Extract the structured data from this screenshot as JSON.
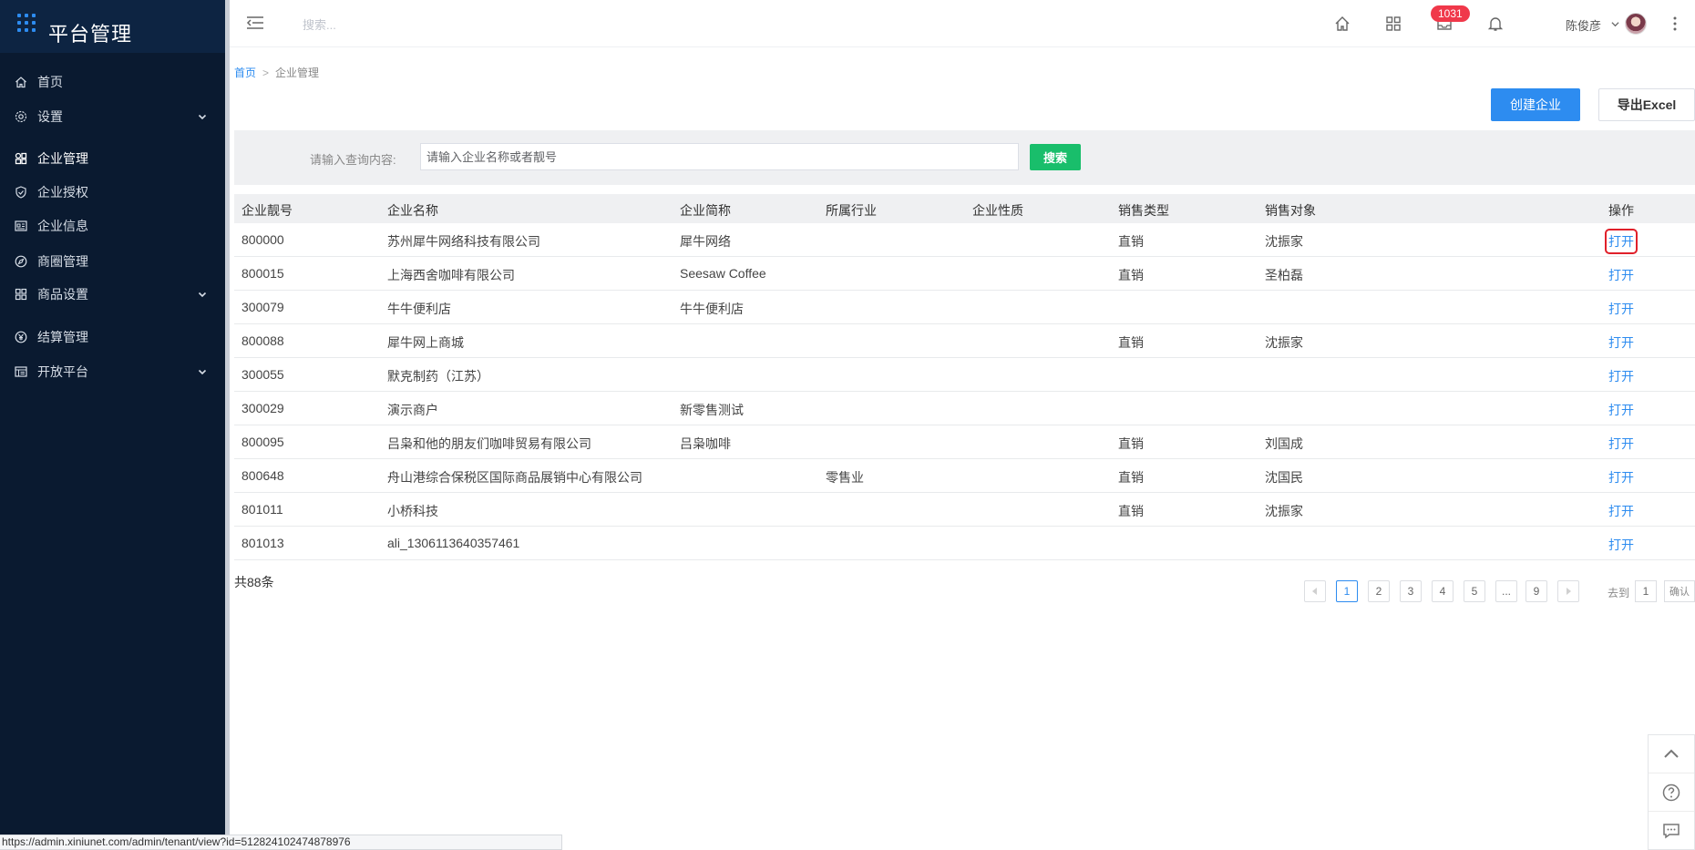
{
  "app": {
    "title": "平台管理"
  },
  "sidebar": {
    "items": [
      {
        "label": "首页",
        "icon": "home-icon",
        "has_children": false,
        "active": false
      },
      {
        "label": "设置",
        "icon": "gear-icon",
        "has_children": true,
        "active": false
      },
      {
        "label": "企业管理",
        "icon": "apps-icon",
        "has_children": false,
        "active": true
      },
      {
        "label": "企业授权",
        "icon": "shield-check-icon",
        "has_children": false,
        "active": false
      },
      {
        "label": "企业信息",
        "icon": "id-card-icon",
        "has_children": false,
        "active": false
      },
      {
        "label": "商圈管理",
        "icon": "compass-icon",
        "has_children": false,
        "active": false
      },
      {
        "label": "商品设置",
        "icon": "grid-icon",
        "has_children": true,
        "active": false
      },
      {
        "label": "结算管理",
        "icon": "yen-circle-icon",
        "has_children": false,
        "active": false
      },
      {
        "label": "开放平台",
        "icon": "list-card-icon",
        "has_children": true,
        "active": false
      }
    ]
  },
  "topbar": {
    "search_placeholder": "搜索...",
    "notification_count": "1031",
    "username": "陈俊彦",
    "icons": [
      "home-icon",
      "grid-icon",
      "message-icon",
      "bell-icon",
      "more-vertical-icon"
    ]
  },
  "breadcrumb": {
    "home": "首页",
    "separator": ">",
    "current": "企业管理"
  },
  "actions": {
    "create_label": "创建企业",
    "export_label": "导出Excel"
  },
  "filter": {
    "label": "请输入查询内容:",
    "placeholder": "请输入企业名称或者靓号",
    "search_label": "搜索"
  },
  "table": {
    "columns": [
      "企业靓号",
      "企业名称",
      "企业简称",
      "所属行业",
      "企业性质",
      "销售类型",
      "销售对象",
      "操作"
    ],
    "action_label": "打开",
    "rows": [
      [
        "800000",
        "苏州犀牛网络科技有限公司",
        "犀牛网络",
        "",
        "",
        "直销",
        "沈振家"
      ],
      [
        "800015",
        "上海西舍咖啡有限公司",
        "Seesaw Coffee",
        "",
        "",
        "直销",
        "圣柏磊"
      ],
      [
        "300079",
        "牛牛便利店",
        "牛牛便利店",
        "",
        "",
        "",
        ""
      ],
      [
        "800088",
        "犀牛网上商城",
        "",
        "",
        "",
        "直销",
        "沈振家"
      ],
      [
        "300055",
        "默克制药（江苏）",
        "",
        "",
        "",
        "",
        ""
      ],
      [
        "300029",
        "演示商户",
        "新零售测试",
        "",
        "",
        "",
        ""
      ],
      [
        "800095",
        "吕枭和他的朋友们咖啡贸易有限公司",
        "吕枭咖啡",
        "",
        "",
        "直销",
        "刘国成"
      ],
      [
        "800648",
        "舟山港综合保税区国际商品展销中心有限公司",
        "",
        "零售业",
        "",
        "直销",
        "沈国民"
      ],
      [
        "801011",
        "小桥科技",
        "",
        "",
        "",
        "直销",
        "沈振家"
      ],
      [
        "801013",
        "ali_1306113640357461",
        "",
        "",
        "",
        "",
        ""
      ]
    ]
  },
  "pagination": {
    "total_text": "共88条",
    "pages": [
      "1",
      "2",
      "3",
      "4",
      "5",
      "...",
      "9"
    ],
    "current": "1",
    "goto_label": "去到",
    "goto_value": "1",
    "confirm_label": "确认"
  },
  "status_url": "https://admin.xiniunet.com/admin/tenant/view?id=512824102474878976",
  "colors": {
    "sidebar_bg": "#0a1a30",
    "primary": "#2d8cf0",
    "success": "#19be6b",
    "badge": "#f0384a",
    "highlight": "#e0202a"
  }
}
